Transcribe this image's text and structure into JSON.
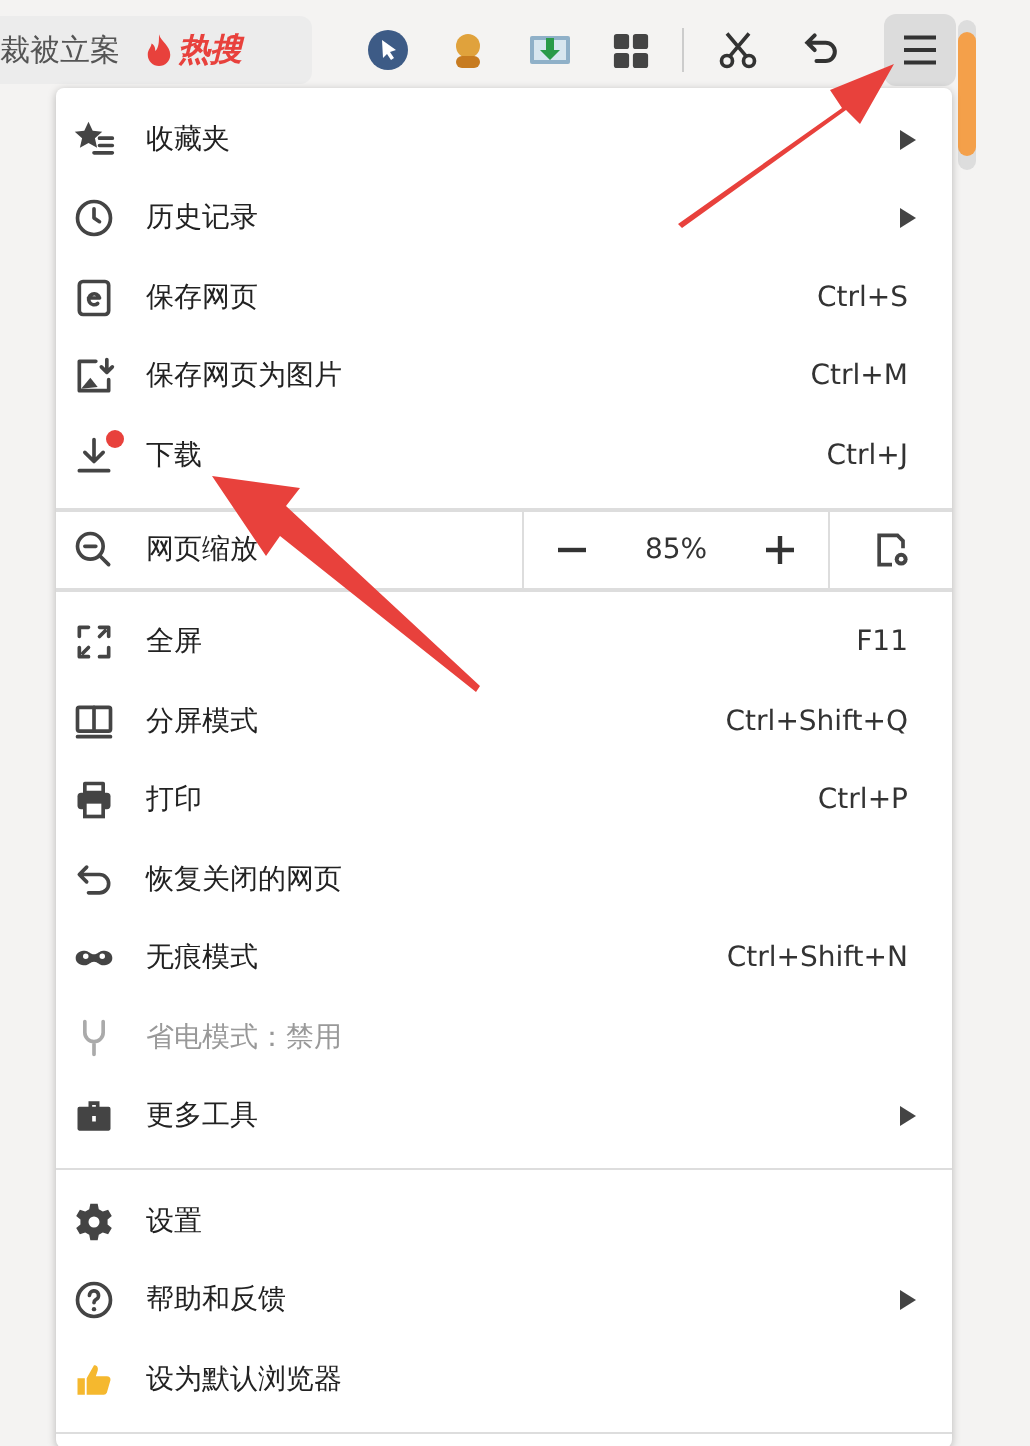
{
  "toolbar": {
    "search_text": "裁被立案",
    "hot_label": "热搜",
    "menu_button_active": true
  },
  "menu": {
    "sections": [
      {
        "items": [
          {
            "kind": "item",
            "label": "收藏夹",
            "submenu": true,
            "disabled": false,
            "dot": false
          },
          {
            "kind": "item",
            "label": "历史记录",
            "submenu": true,
            "disabled": false,
            "dot": false
          },
          {
            "kind": "item",
            "label": "保存网页",
            "shortcut": "Ctrl+S",
            "submenu": false,
            "disabled": false,
            "dot": false
          },
          {
            "kind": "item",
            "label": "保存网页为图片",
            "shortcut": "Ctrl+M",
            "submenu": false,
            "disabled": false,
            "dot": false
          },
          {
            "kind": "item",
            "label": "下载",
            "shortcut": "Ctrl+J",
            "submenu": false,
            "disabled": false,
            "dot": true
          }
        ]
      },
      {
        "items": [
          {
            "kind": "zoom",
            "label": "网页缩放",
            "value": "85%"
          }
        ]
      },
      {
        "items": [
          {
            "kind": "item",
            "label": "全屏",
            "shortcut": "F11",
            "submenu": false,
            "disabled": false,
            "dot": false
          },
          {
            "kind": "item",
            "label": "分屏模式",
            "shortcut": "Ctrl+Shift+Q",
            "submenu": false,
            "disabled": false,
            "dot": false
          },
          {
            "kind": "item",
            "label": "打印",
            "shortcut": "Ctrl+P",
            "submenu": false,
            "disabled": false,
            "dot": false
          },
          {
            "kind": "item",
            "label": "恢复关闭的网页",
            "submenu": false,
            "disabled": false,
            "dot": false
          },
          {
            "kind": "item",
            "label": "无痕模式",
            "shortcut": "Ctrl+Shift+N",
            "submenu": false,
            "disabled": false,
            "dot": false
          },
          {
            "kind": "item",
            "label": "省电模式：禁用",
            "submenu": false,
            "disabled": true,
            "dot": false
          },
          {
            "kind": "item",
            "label": "更多工具",
            "submenu": true,
            "disabled": false,
            "dot": false
          }
        ]
      },
      {
        "items": [
          {
            "kind": "item",
            "label": "设置",
            "submenu": false,
            "disabled": false,
            "dot": false
          },
          {
            "kind": "item",
            "label": "帮助和反馈",
            "submenu": true,
            "disabled": false,
            "dot": false
          },
          {
            "kind": "item",
            "label": "设为默认浏览器",
            "submenu": false,
            "disabled": false,
            "dot": false
          }
        ]
      }
    ]
  }
}
